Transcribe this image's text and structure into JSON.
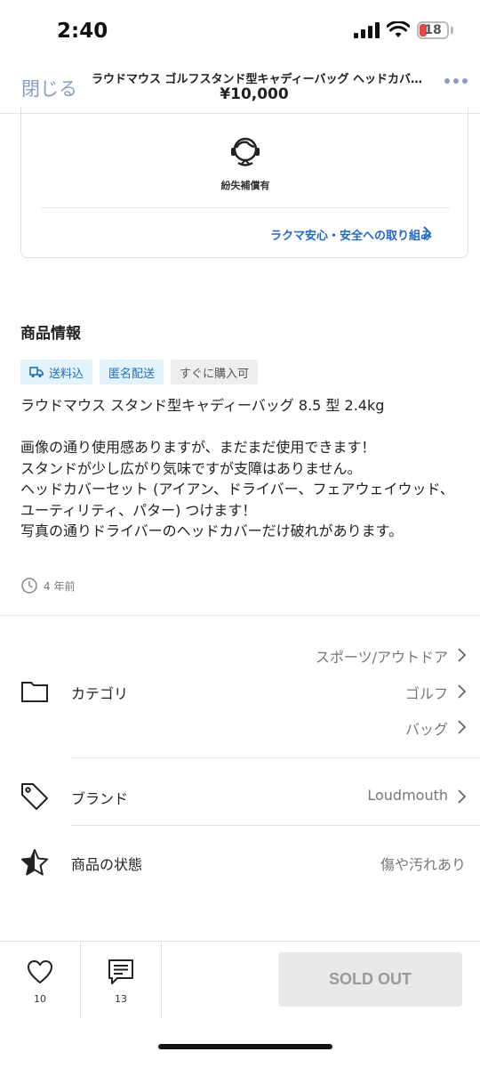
{
  "status_bar": {
    "time": "2:40",
    "battery": "18"
  },
  "nav": {
    "close_label": "閉じる",
    "title": "ラウドマウス ゴルフスタンド型キャディーバッグ ヘッドカバ…",
    "price": "¥10,000"
  },
  "safety": {
    "label": "紛失補償有",
    "link": "ラクマ安心・安全への取り組み"
  },
  "product_info": {
    "title": "商品情報",
    "tags": [
      {
        "label": "送料込",
        "style": "blue",
        "icon": "truck-icon"
      },
      {
        "label": "匿名配送",
        "style": "blue"
      },
      {
        "label": "すぐに購入可",
        "style": "gray"
      }
    ],
    "description": "ラウドマウス スタンド型キャディーバッグ 8.5 型 2.4kg\n\n画像の通り使用感ありますが、まだまだ使用できます！\nスタンドが少し広がり気味ですが支障はありません。\nヘッドカバーセット (アイアン、ドライバー、フェアウェイウッド、ユーティリティ、パター) つけます！\n写真の通りドライバーのヘッドカバーだけ破れがあります。",
    "posted": "4 年前"
  },
  "details": {
    "category_label": "カテゴリ",
    "categories": [
      "スポーツ/アウトドア",
      "ゴルフ",
      "バッグ"
    ],
    "brand_label": "ブランド",
    "brand": "Loudmouth",
    "condition_label": "商品の状態",
    "condition": "傷や汚れあり"
  },
  "bottom_bar": {
    "likes": "10",
    "comments": "13",
    "sold_out": "SOLD OUT"
  },
  "colors": {
    "link": "#2368c4",
    "nav_accent": "#8a9cbf",
    "tag_blue_bg": "#e3f3fc"
  }
}
